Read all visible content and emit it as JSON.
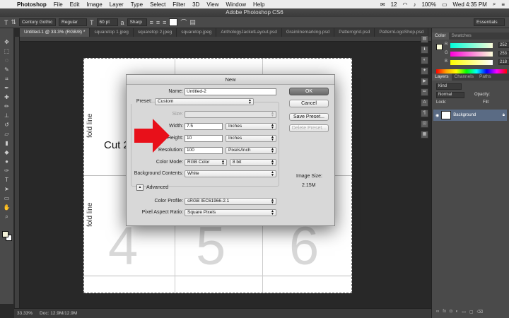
{
  "menubar": {
    "app_name": "Photoshop",
    "items": [
      "File",
      "Edit",
      "Image",
      "Layer",
      "Type",
      "Select",
      "Filter",
      "3D",
      "View",
      "Window",
      "Help"
    ],
    "notification_count": "12",
    "battery": "100%",
    "clock": "Wed 4:35 PM"
  },
  "window": {
    "title": "Adobe Photoshop CS6"
  },
  "options_bar": {
    "font_family": "Century Gothic",
    "font_style": "Regular",
    "font_size": "60 pt",
    "antialias": "Sharp",
    "workspace": "Essentials"
  },
  "tabs": [
    "Untitled-1 @ 33.3% (RGB/8) *",
    "squaretop 1.jpeg",
    "squaretop 2.jpeg",
    "squaretop.jpeg",
    "AnthologyJacketLayout.psd",
    "Grainlinemarking.psd",
    "Patterngrid.psd",
    "PatternLogoShop.psd"
  ],
  "document": {
    "fold_label_1": "fold line",
    "fold_label_2": "fold line",
    "cut_text": "Cut 2",
    "digit_4": "4",
    "digit_5": "5",
    "digit_6": "6"
  },
  "status": {
    "zoom": "33.33%",
    "doc_size": "Doc: 12.9M/12.9M"
  },
  "color_panel": {
    "tabs": [
      "Color",
      "Swatches"
    ],
    "r_label": "R",
    "r_value": "252",
    "g_label": "G",
    "g_value": "253",
    "b_label": "B",
    "b_value": "218"
  },
  "layers_panel": {
    "tabs": [
      "Layers",
      "Channels",
      "Paths"
    ],
    "kind": "Kind",
    "blend": "Normal",
    "opacity_label": "Opacity:",
    "fill_label": "Fill:",
    "lock_label": "Lock:",
    "layer_name": "Background"
  },
  "dialog": {
    "title": "New",
    "name_label": "Name:",
    "name_value": "Untitled-2",
    "preset_label": "Preset:",
    "preset_value": "Custom",
    "size_label": "Size:",
    "width_label": "Width:",
    "width_value": "7.5",
    "width_unit": "Inches",
    "height_label": "Height:",
    "height_value": "10",
    "height_unit": "Inches",
    "resolution_label": "Resolution:",
    "resolution_value": "100",
    "resolution_unit": "Pixels/Inch",
    "color_mode_label": "Color Mode:",
    "color_mode_value": "RGB Color",
    "bit_depth": "8 bit",
    "bg_label": "Background Contents:",
    "bg_value": "White",
    "advanced_label": "Advanced",
    "profile_label": "Color Profile:",
    "profile_value": "sRGB IEC61966-2.1",
    "pixel_aspect_label": "Pixel Aspect Ratio:",
    "pixel_aspect_value": "Square Pixels",
    "ok_label": "OK",
    "cancel_label": "Cancel",
    "save_preset_label": "Save Preset...",
    "delete_preset_label": "Delete Preset...",
    "image_size_label": "Image Size:",
    "image_size_value": "2.15M"
  },
  "colors": {
    "arrow_red": "#e8101a",
    "selected_layer": "#5a6b84",
    "panel_bg": "#4a4a4a"
  }
}
